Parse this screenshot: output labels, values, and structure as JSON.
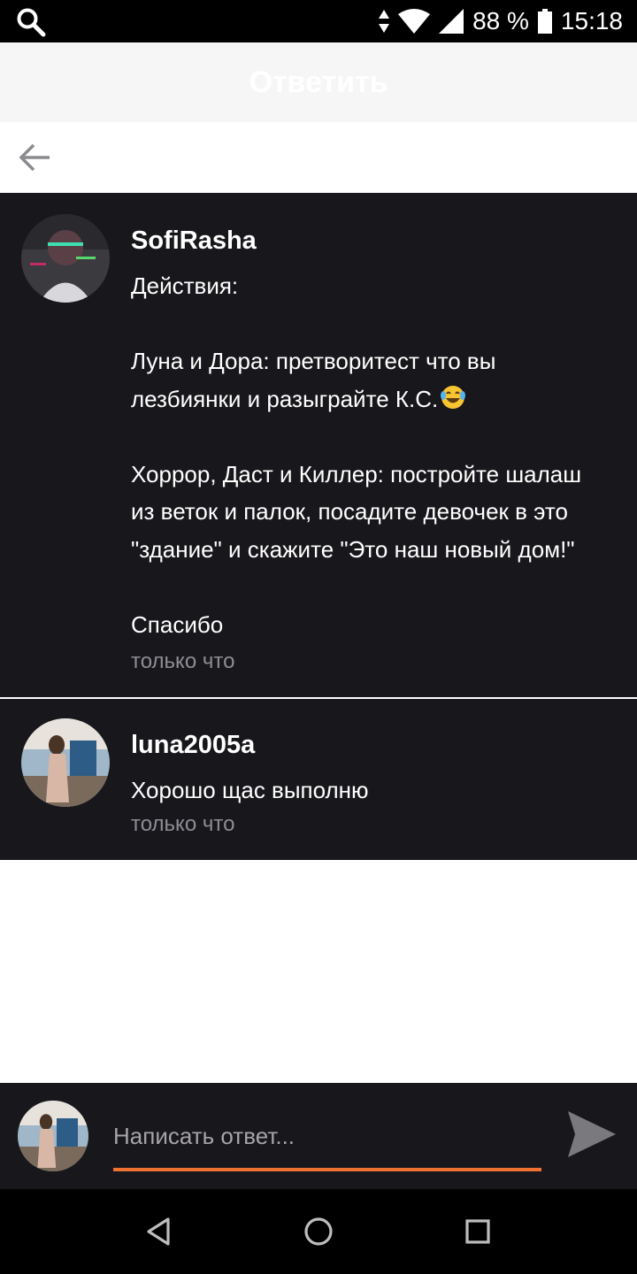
{
  "status_bar": {
    "battery": "88 %",
    "time": "15:18"
  },
  "header": {
    "title": "Ответить"
  },
  "comments": [
    {
      "author": "SofiRasha",
      "lines": [
        "Действия:",
        "",
        "Луна и Дора: претворитест что вы",
        "лезбиянки и разыграйте К.С.",
        "",
        "Хоррор, Даст и Киллер: постройте шалаш",
        "из веток и палок, посадите девочек в это",
        "\"здание\" и скажите \"Это наш новый дом!\"",
        "",
        "Спасибо"
      ],
      "time": "только что"
    },
    {
      "author": "luna2005a",
      "text": "Хорошо щас выполню",
      "time": "только что"
    }
  ],
  "reply": {
    "placeholder": "Написать ответ..."
  },
  "icons": {
    "search": "search-icon",
    "back": "arrow-left-icon",
    "send": "send-icon",
    "emoji": "face-with-tears-of-joy-icon",
    "nav_back": "triangle-back-icon",
    "nav_home": "circle-home-icon",
    "nav_recent": "square-recents-icon"
  },
  "colors": {
    "comment_bg": "#18171b",
    "accent": "#f07232",
    "time_text": "#8f8d93"
  }
}
